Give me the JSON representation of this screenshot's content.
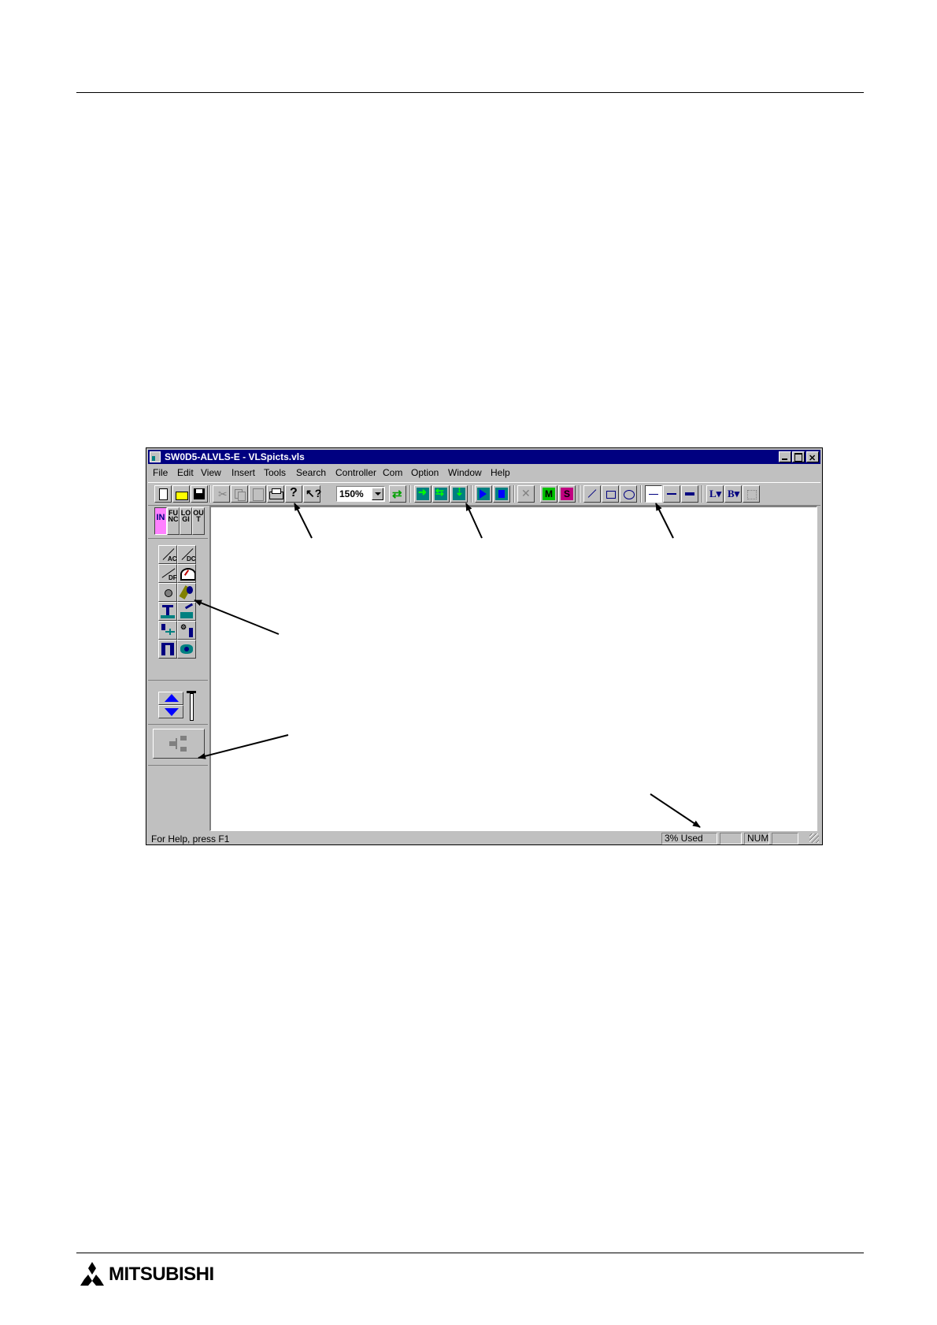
{
  "window": {
    "title": "SW0D5-ALVLS-E - VLSpicts.vls"
  },
  "menu": [
    "File",
    "Edit",
    "View",
    "Insert",
    "Tools",
    "Search",
    "Controller",
    "Com",
    "Option",
    "Window",
    "Help"
  ],
  "toolbar": {
    "zoom_value": "150%"
  },
  "left_panel": {
    "tabs": [
      "IN",
      "FUNC",
      "LOGI",
      "OUT"
    ]
  },
  "statusbar": {
    "help_text": "For Help, press F1",
    "memory_used": "3% Used",
    "num_indicator": "NUM"
  },
  "footer": {
    "brand": "MITSUBISHI"
  },
  "colors": {
    "titlebar": "#000080",
    "face": "#c0c0c0"
  }
}
